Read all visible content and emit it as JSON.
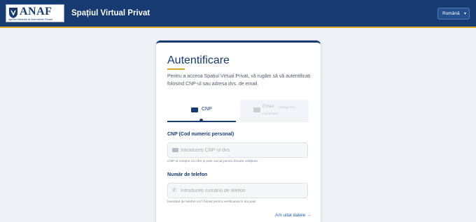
{
  "header": {
    "logo_text": "ANAF",
    "logo_subtitle": "Agenția Națională de Administrare Fiscală",
    "title": "Spațiul Virtual Privat",
    "language": "Română",
    "language_icon": "chevron-down-icon",
    "bar_color": "#163a72",
    "accent_color": "#d8a920"
  },
  "card": {
    "title": "Autentificare",
    "description": "Pentru a accesa Spațiul Virtual Privat, vă rugăm să vă autentificați folosind CNP-ul sau adresa dvs. de email.",
    "tabs": [
      {
        "label": "CNP",
        "icon": "id-card-icon",
        "active": true
      },
      {
        "label": "Email",
        "note": "(indisponibil momentan)",
        "icon": "envelope-icon",
        "active": false
      }
    ],
    "cnp": {
      "label": "CNP (Cod numeric personal)",
      "placeholder": "Introduceți CNP-ul dvs.",
      "hint": "CNP-ul conține 13 cifre și este unicat pentru fiecare cetățean."
    },
    "phone": {
      "label": "Număr de telefon",
      "placeholder": "Introduceți numărul de telefon",
      "hint": "Numărul de telefon va fi folosit pentru verificarea în doi pași."
    },
    "forgot_link": "Am uitat datele →"
  }
}
